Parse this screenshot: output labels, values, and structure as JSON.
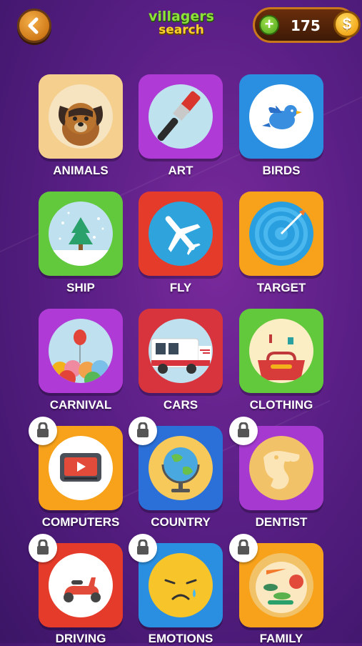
{
  "header": {
    "logo_line1": "villagers",
    "logo_line2": "search",
    "coins": "175",
    "coin_symbol": "$",
    "add_symbol": "+"
  },
  "categories": [
    {
      "label": "ANIMALS",
      "color": "#f5cf8d",
      "icon": "dog-icon",
      "locked": false
    },
    {
      "label": "ART",
      "color": "#b03ad6",
      "icon": "paintbrush-icon",
      "locked": false
    },
    {
      "label": "BIRDS",
      "color": "#2a8fe0",
      "icon": "bird-icon",
      "locked": false
    },
    {
      "label": "SHIP",
      "color": "#62c83c",
      "icon": "snow-globe-icon",
      "locked": false
    },
    {
      "label": "FLY",
      "color": "#e53b2a",
      "icon": "airplane-icon",
      "locked": false
    },
    {
      "label": "TARGET",
      "color": "#f7a21a",
      "icon": "target-icon",
      "locked": false
    },
    {
      "label": "CARNIVAL",
      "color": "#b03ad6",
      "icon": "balloons-icon",
      "locked": false
    },
    {
      "label": "CARS",
      "color": "#d8343e",
      "icon": "truck-icon",
      "locked": false
    },
    {
      "label": "CLOTHING",
      "color": "#62c83c",
      "icon": "handbag-icon",
      "locked": false
    },
    {
      "label": "COMPUTERS",
      "color": "#f7a21a",
      "icon": "tv-icon",
      "locked": true
    },
    {
      "label": "COUNTRY",
      "color": "#2a70d8",
      "icon": "globe-icon",
      "locked": true
    },
    {
      "label": "DENTIST",
      "color": "#a63ad0",
      "icon": "dinosaur-icon",
      "locked": true
    },
    {
      "label": "DRIVING",
      "color": "#e53b2a",
      "icon": "scooter-icon",
      "locked": true
    },
    {
      "label": "EMOTIONS",
      "color": "#2a8fe0",
      "icon": "sad-face-icon",
      "locked": true
    },
    {
      "label": "FAMILY",
      "color": "#f7a21a",
      "icon": "food-plate-icon",
      "locked": true
    }
  ]
}
